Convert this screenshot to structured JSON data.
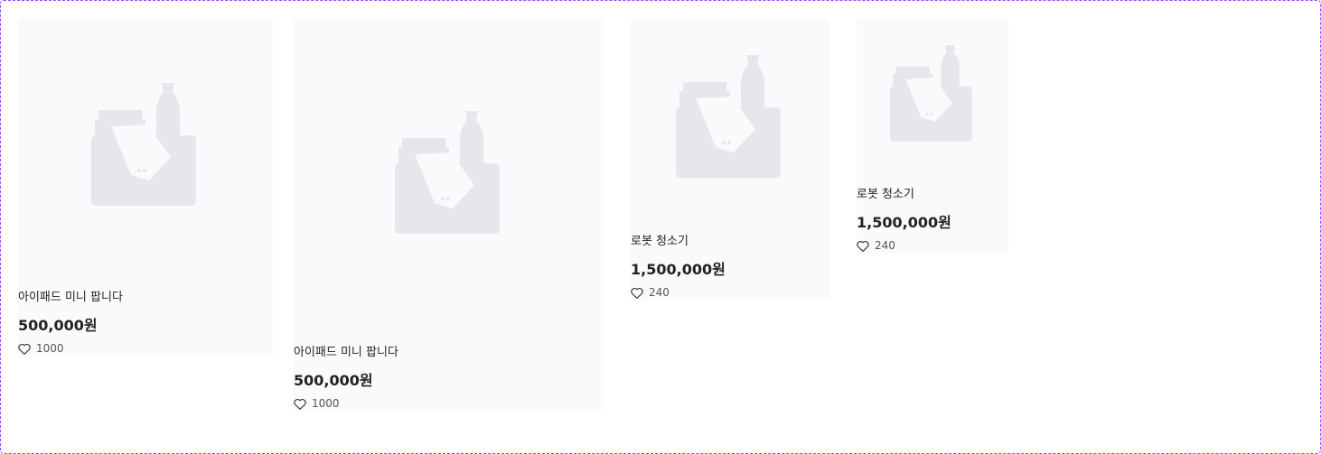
{
  "products": [
    {
      "title": "아이패드 미니 팝니다",
      "price": "500,000원",
      "likes": "1000",
      "image_icon": "image-placeholder-icon",
      "like_icon": "heart-icon"
    },
    {
      "title": "아이패드 미니 팝니다",
      "price": "500,000원",
      "likes": "1000",
      "image_icon": "image-placeholder-icon",
      "like_icon": "heart-icon"
    },
    {
      "title": "로봇 청소기",
      "price": "1,500,000원",
      "likes": "240",
      "image_icon": "image-placeholder-icon",
      "like_icon": "heart-icon"
    },
    {
      "title": "로봇 청소기",
      "price": "1,500,000원",
      "likes": "240",
      "image_icon": "image-placeholder-icon",
      "like_icon": "heart-icon"
    }
  ],
  "colors": {
    "frame_border": "#9747ff",
    "placeholder_bg": "#f9fafb",
    "placeholder_shape": "#e5e7eb",
    "text": "#222222"
  }
}
